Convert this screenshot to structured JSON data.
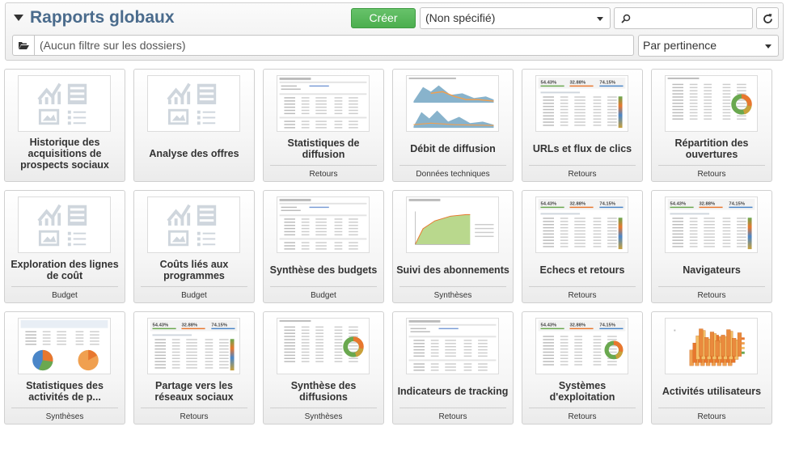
{
  "header": {
    "title": "Rapports globaux",
    "create_label": "Créer",
    "type_select": "(Non spécifié)",
    "search_value": "",
    "folder_filter": "(Aucun filtre sur les dossiers)",
    "sort_select": "Par pertinence"
  },
  "reports": [
    {
      "title": "Historique des acquisitions de prospects sociaux",
      "category": "",
      "thumb": "placeholder"
    },
    {
      "title": "Analyse des offres",
      "category": "",
      "thumb": "placeholder"
    },
    {
      "title": "Statistiques de diffusion",
      "category": "Retours",
      "thumb": "table"
    },
    {
      "title": "Débit de diffusion",
      "category": "Données techniques",
      "thumb": "area"
    },
    {
      "title": "URLs et flux de clics",
      "category": "Retours",
      "thumb": "kpi-table"
    },
    {
      "title": "Répartition des ouvertures",
      "category": "Retours",
      "thumb": "donut"
    },
    {
      "title": "Exploration des lignes de coût",
      "category": "Budget",
      "thumb": "placeholder"
    },
    {
      "title": "Coûts liés aux programmes",
      "category": "Budget",
      "thumb": "placeholder"
    },
    {
      "title": "Synthèse des budgets",
      "category": "Budget",
      "thumb": "table"
    },
    {
      "title": "Suivi des abonnements",
      "category": "Synthèses",
      "thumb": "growth"
    },
    {
      "title": "Echecs et retours",
      "category": "Retours",
      "thumb": "kpi-table"
    },
    {
      "title": "Navigateurs",
      "category": "Retours",
      "thumb": "kpi-table"
    },
    {
      "title": "Statistiques des activités de p...",
      "category": "Synthèses",
      "thumb": "pies"
    },
    {
      "title": "Partage vers les réseaux sociaux",
      "category": "Retours",
      "thumb": "kpi-table"
    },
    {
      "title": "Synthèse des diffusions",
      "category": "Synthèses",
      "thumb": "donut"
    },
    {
      "title": "Indicateurs de tracking",
      "category": "Retours",
      "thumb": "table"
    },
    {
      "title": "Systèmes d'exploitation",
      "category": "Retours",
      "thumb": "kpi-donut"
    },
    {
      "title": "Activités utilisateurs",
      "category": "Retours",
      "thumb": "bars3d"
    }
  ],
  "kpi_thumb_values": [
    "54.43%",
    "32.88%",
    "74.15%"
  ],
  "colors": {
    "title": "#4a6b8c",
    "create_button": "#4cae4f",
    "donut_green": "#6aa84f",
    "donut_orange": "#e8772e",
    "area_blue": "#6aa0bf",
    "area_orange": "#f0a050"
  }
}
